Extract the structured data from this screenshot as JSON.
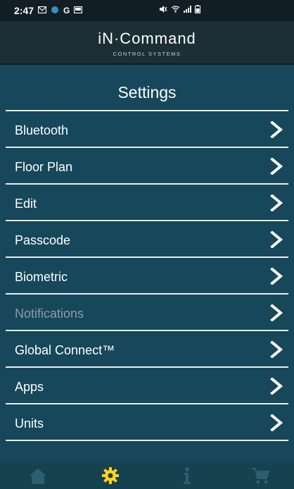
{
  "status_bar": {
    "time": "2:47",
    "left_icons": [
      "mail-icon",
      "weather-icon",
      "google-icon",
      "screen-icon"
    ],
    "right_icons": [
      "mute-icon",
      "wifi-icon",
      "signal-icon",
      "battery-icon"
    ]
  },
  "header": {
    "brand": "iN·Command",
    "subtitle": "CONTROL SYSTEMS"
  },
  "page": {
    "title": "Settings"
  },
  "menu": [
    {
      "label": "Bluetooth",
      "enabled": true
    },
    {
      "label": "Floor Plan",
      "enabled": true
    },
    {
      "label": "Edit",
      "enabled": true
    },
    {
      "label": "Passcode",
      "enabled": true
    },
    {
      "label": "Biometric",
      "enabled": true
    },
    {
      "label": "Notifications",
      "enabled": false
    },
    {
      "label": "Global Connect™",
      "enabled": true
    },
    {
      "label": "Apps",
      "enabled": true
    },
    {
      "label": "Units",
      "enabled": true
    }
  ],
  "tabbar": {
    "tabs": [
      {
        "name": "home-icon",
        "active": false
      },
      {
        "name": "gear-icon",
        "active": true
      },
      {
        "name": "info-icon",
        "active": false
      },
      {
        "name": "cart-icon",
        "active": false
      }
    ]
  },
  "colors": {
    "background": "#16475a",
    "header_bg": "#1c2e36",
    "status_bg": "#111f25",
    "active_tab": "#ffd21f",
    "inactive_tab": "#2c5f72"
  }
}
